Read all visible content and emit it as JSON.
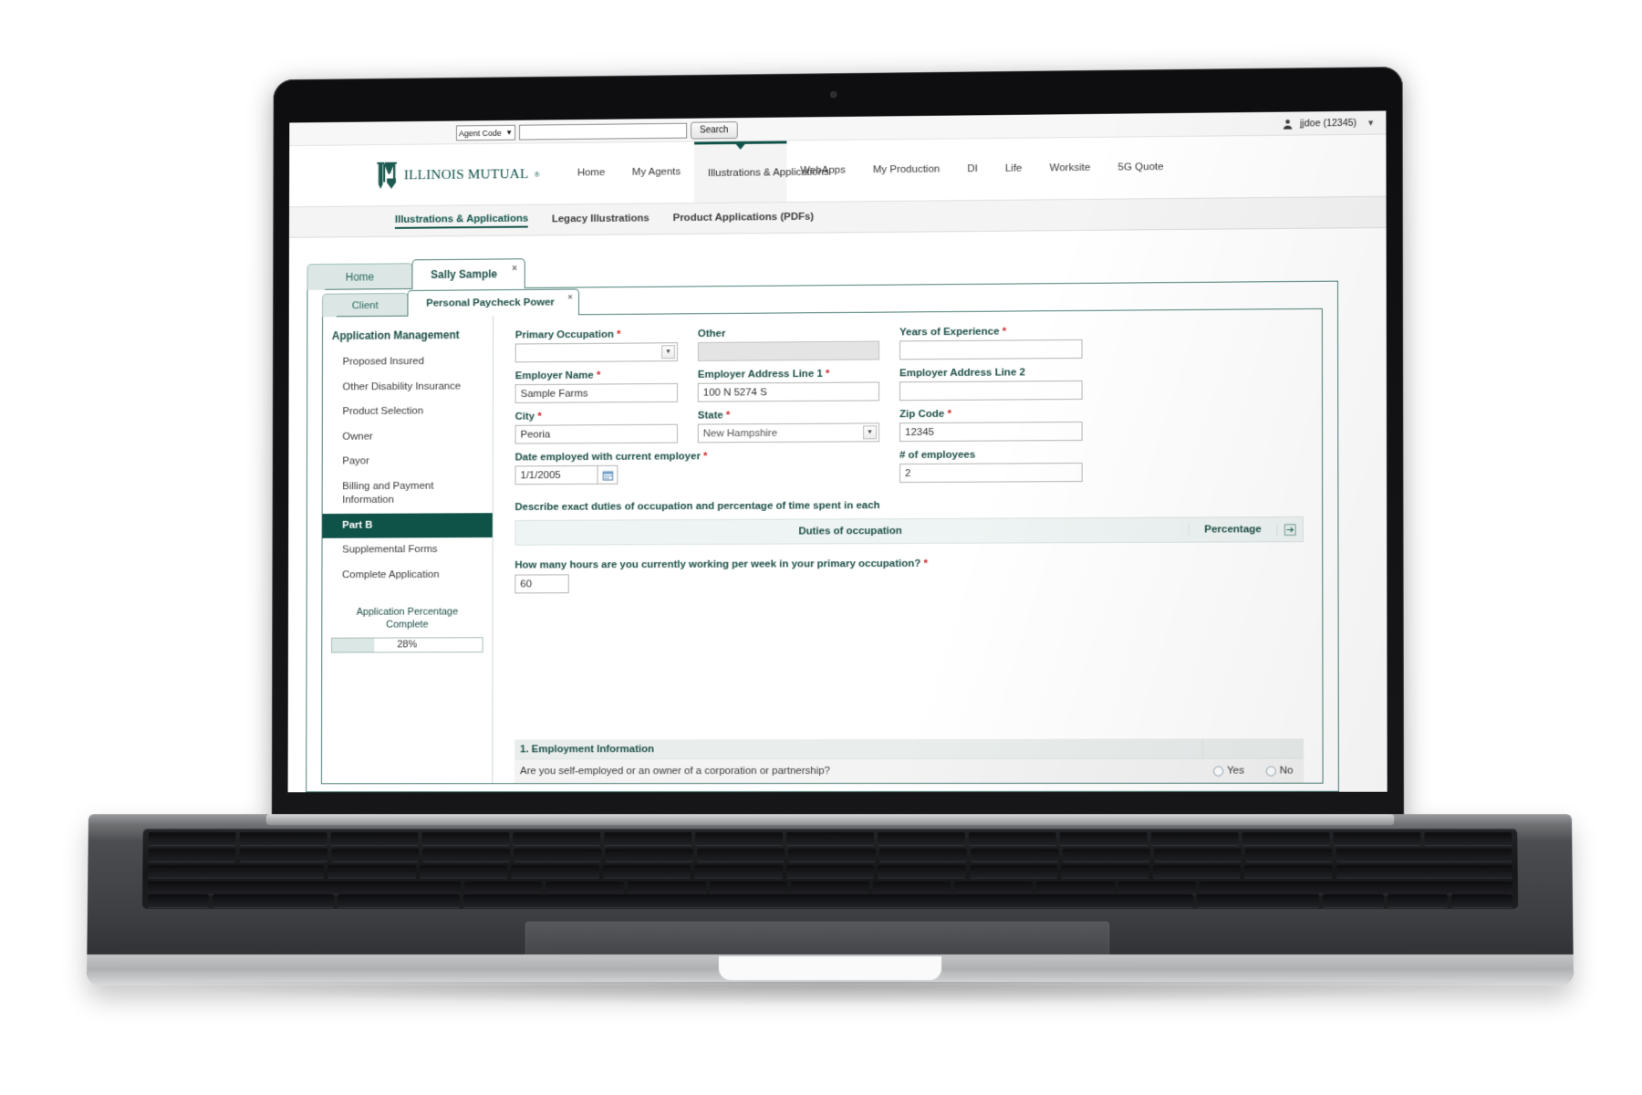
{
  "utility": {
    "agent_code_label": "Agent Code",
    "search_value": "",
    "search_placeholder": "",
    "search_button": "Search",
    "user_name": "jjdoe (12345)"
  },
  "brand": {
    "name": "ILLINOIS MUTUAL",
    "registered": "®"
  },
  "main_nav": [
    {
      "label": "Home",
      "active": false
    },
    {
      "label": "My Agents",
      "active": false
    },
    {
      "label": "Illustrations & Applications",
      "active": true
    },
    {
      "label": "WebApps",
      "active": false
    },
    {
      "label": "My Production",
      "active": false
    },
    {
      "label": "DI",
      "active": false
    },
    {
      "label": "Life",
      "active": false
    },
    {
      "label": "Worksite",
      "active": false
    },
    {
      "label": "5G Quote",
      "active": false
    }
  ],
  "sub_nav": [
    {
      "label": "Illustrations & Applications",
      "active": true
    },
    {
      "label": "Legacy Illustrations",
      "active": false
    },
    {
      "label": "Product Applications (PDFs)",
      "active": false
    }
  ],
  "tabs_level1": [
    {
      "label": "Home",
      "active": false,
      "closable": false
    },
    {
      "label": "Sally Sample",
      "active": true,
      "closable": true,
      "close": "×"
    }
  ],
  "tabs_level2": [
    {
      "label": "Client",
      "active": false,
      "closable": false
    },
    {
      "label": "Personal Paycheck Power",
      "active": true,
      "closable": true,
      "close": "×"
    }
  ],
  "sidebar": {
    "title": "Application Management",
    "items": [
      {
        "label": "Proposed Insured",
        "active": false
      },
      {
        "label": "Other Disability Insurance",
        "active": false
      },
      {
        "label": "Product Selection",
        "active": false
      },
      {
        "label": "Owner",
        "active": false
      },
      {
        "label": "Payor",
        "active": false
      },
      {
        "label": "Billing and Payment Information",
        "active": false
      },
      {
        "label": "Part B",
        "active": true
      },
      {
        "label": "Supplemental Forms",
        "active": false
      },
      {
        "label": "Complete Application",
        "active": false
      }
    ],
    "progress": {
      "label_line1": "Application Percentage",
      "label_line2": "Complete",
      "value_text": "28%",
      "value": 28
    }
  },
  "form": {
    "primary_occupation": {
      "label": "Primary Occupation",
      "required": true,
      "value": "",
      "type": "select"
    },
    "other": {
      "label": "Other",
      "required": false,
      "value": "",
      "type": "text",
      "disabled": true
    },
    "years_of_experience": {
      "label": "Years of Experience",
      "required": true,
      "value": "",
      "type": "text"
    },
    "employer_name": {
      "label": "Employer Name",
      "required": true,
      "value": "Sample Farms",
      "type": "text"
    },
    "employer_address_1": {
      "label": "Employer Address Line 1",
      "required": true,
      "value": "100 N 5274 S",
      "type": "text"
    },
    "employer_address_2": {
      "label": "Employer Address Line 2",
      "required": false,
      "value": "",
      "type": "text"
    },
    "city": {
      "label": "City",
      "required": true,
      "value": "Peoria",
      "type": "text"
    },
    "state": {
      "label": "State",
      "required": true,
      "value": "New Hampshire",
      "type": "select"
    },
    "zip_code": {
      "label": "Zip Code",
      "required": true,
      "value": "12345",
      "type": "text"
    },
    "date_employed": {
      "label": "Date employed with current employer",
      "required": true,
      "value": "1/1/2005",
      "type": "date"
    },
    "num_employees": {
      "label": "# of employees",
      "required": false,
      "value": "2",
      "type": "text"
    },
    "duties_note": "Describe exact duties of occupation and percentage of time spent in each",
    "duties_table": {
      "col_duties": "Duties of occupation",
      "col_percentage": "Percentage",
      "rows": []
    },
    "hours_question": {
      "label": "How many hours are you currently working per week in your primary occupation?",
      "required": true,
      "value": "60"
    }
  },
  "employment_section": {
    "title": "1. Employment Information",
    "question": "Are you self-employed or an owner of a corporation or partnership?",
    "options": [
      {
        "label": "Yes",
        "selected": false
      },
      {
        "label": "No",
        "selected": false
      }
    ]
  },
  "colors": {
    "brand_teal": "#0f5248",
    "label_teal": "#1d4f47",
    "required_red": "#cc2222",
    "tab_inactive": "#dce7e5"
  }
}
